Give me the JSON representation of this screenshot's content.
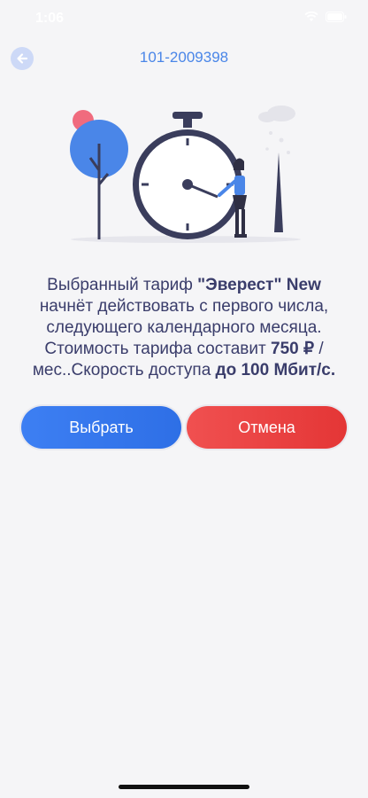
{
  "status_bar": {
    "time": "1:06"
  },
  "header": {
    "title": "101-2009398"
  },
  "message": {
    "line1_prefix": "Выбранный тариф ",
    "tariff_name": "\"Эверест\" New",
    "line2": "начнёт действовать с первого числа, следующего календарного месяца.",
    "line3_prefix": "Стоимость тарифа составит ",
    "price": "750 ₽",
    "line3_suffix": " / мес..Скорость доступа ",
    "speed": "до 100 Мбит/с."
  },
  "buttons": {
    "select_label": "Выбрать",
    "cancel_label": "Отмена"
  },
  "colors": {
    "accent": "#4a86e8",
    "select": "#3d7ff3",
    "cancel": "#e84040",
    "text": "#3a3d6b"
  }
}
